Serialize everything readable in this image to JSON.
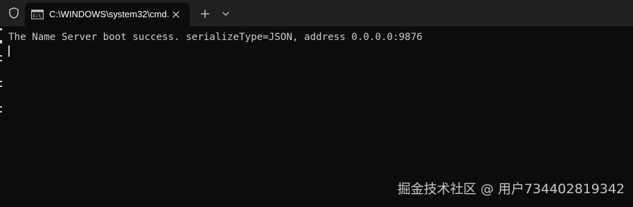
{
  "titlebar": {
    "shield_icon": "shield-icon",
    "tab": {
      "icon": "cmd-icon",
      "title": "C:\\WINDOWS\\system32\\cmd.",
      "close_icon": "close-icon"
    },
    "new_tab_icon": "plus-icon",
    "dropdown_icon": "chevron-down-icon"
  },
  "terminal": {
    "lines": [
      "The Name Server boot success. serializeType=JSON, address 0.0.0.0:9876"
    ],
    "text_color": "#cccccc",
    "background": "#0c0c0c"
  },
  "watermark": {
    "text": "掘金技术社区 @ 用户734402819342"
  },
  "colors": {
    "titlebar_bg": "#202020",
    "tab_bg": "#0c0c0c"
  }
}
